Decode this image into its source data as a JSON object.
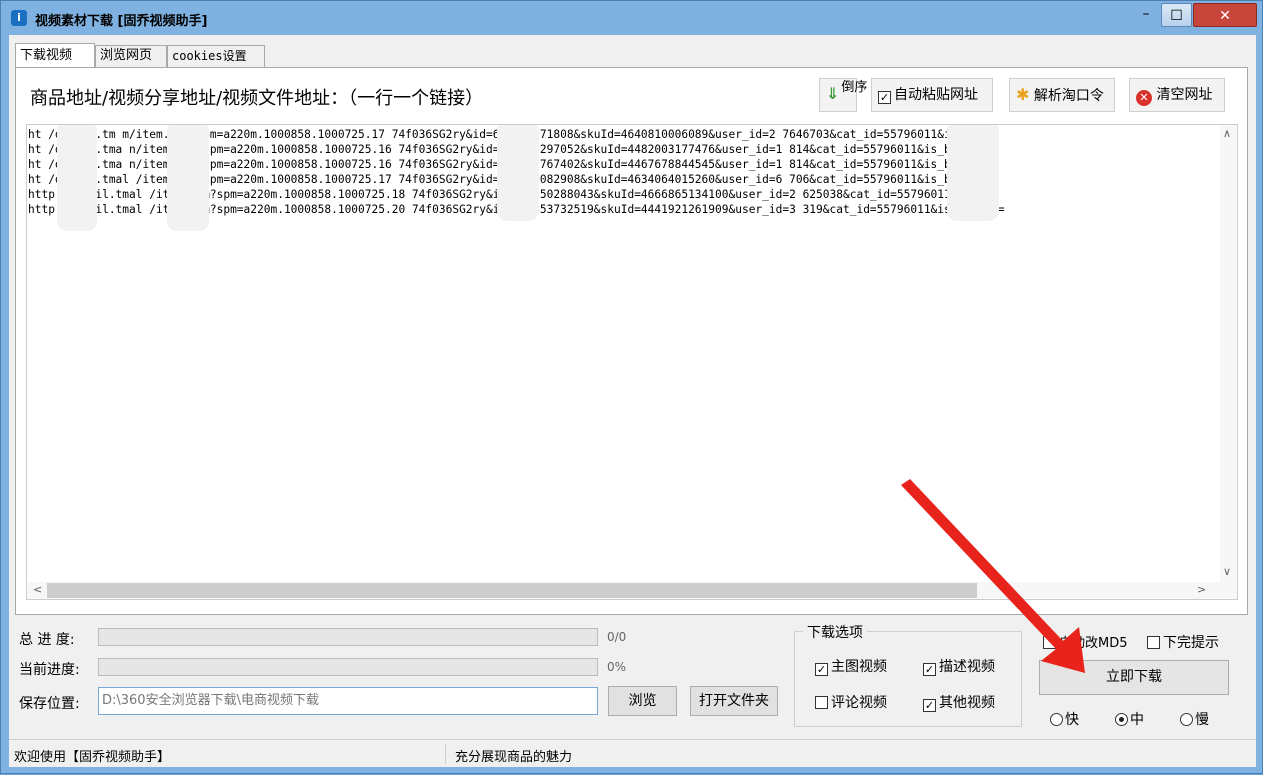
{
  "window": {
    "title": "视频素材下载 [固乔视频助手]",
    "icon_label": "i",
    "minimize": "–",
    "maximize": "☐",
    "close": "✕"
  },
  "tabs": [
    {
      "label": "下载视频",
      "active": true
    },
    {
      "label": "浏览网页",
      "active": false
    },
    {
      "label": "cookies设置",
      "active": false
    }
  ],
  "toolbar": {
    "address_label": "商品地址/视频分享地址/视频文件地址：（一行一个链接）",
    "reverse_label": "倒序",
    "auto_paste_label": "自动粘贴网址",
    "auto_paste_checked": true,
    "parse_label": "解析淘口令",
    "clear_label": "清空网址"
  },
  "urls": [
    "ht      /detail.tm     m/item.htm?spm=a220m.1000858.1000725.17     74f036SG2ry&id=629614071808&skuId=4640810006089&user_id=2      7646703&cat_id=55796011&is_b=1",
    "ht      /detail.tma    n/item.htm?spm=a220m.1000858.1000725.16     74f036SG2ry&id=629832297052&skuId=4482003177476&user_id=1      814&cat_id=55796011&is_b=1&rn=",
    "ht      /detail.tma    n/item.htm?spm=a220m.1000858.1000725.16     74f036SG2ry&id=629545767402&skuId=4467678844545&user_id=1      814&cat_id=55796011&is_b=1&rn=",
    "ht      /detail.tmal   /item.htm?spm=a220m.1000858.1000725.17     74f036SG2ry&id=628450082908&skuId=4634064015260&user_id=6      706&cat_id=55796011&is_b=1&rn=",
    "http    /detail.tmal   /item.htm?spm=a220m.1000858.1000725.18     74f036SG2ry&id=630750288043&skuId=4666865134100&user_id=2      625038&cat_id=55796011&is_b=",
    "http    /detail.tmal   /item.htm?spm=a220m.1000858.1000725.20     74f036SG2ry&id=625853732519&skuId=4441921261909&user_id=3      319&cat_id=55796011&is_b=1&rn="
  ],
  "progress": {
    "total_label": "总 进 度:",
    "total_value": "0/0",
    "current_label": "当前进度:",
    "current_value": "0%"
  },
  "save": {
    "label": "保存位置:",
    "path": "D:\\360安全浏览器下载\\电商视频下载",
    "browse_label": "浏览",
    "open_folder_label": "打开文件夹"
  },
  "download_options": {
    "title": "下载选项",
    "main_video": {
      "label": "主图视频",
      "checked": true
    },
    "desc_video": {
      "label": "描述视频",
      "checked": true
    },
    "review_video": {
      "label": "评论视频",
      "checked": false
    },
    "other_video": {
      "label": "其他视频",
      "checked": true
    }
  },
  "extra": {
    "auto_md5_label": "自动改MD5",
    "auto_md5_checked": false,
    "done_prompt_label": "下完提示",
    "done_prompt_checked": false,
    "download_now_label": "立即下载",
    "speed_fast": "快",
    "speed_mid": "中",
    "speed_slow": "慢",
    "speed_selected": "中"
  },
  "status": {
    "left": "欢迎使用【固乔视频助手】",
    "right": "充分展现商品的魅力"
  },
  "colors": {
    "frame": "#7fb2e0",
    "close_button": "#c7453a",
    "annotation_arrow": "#e8231b"
  }
}
